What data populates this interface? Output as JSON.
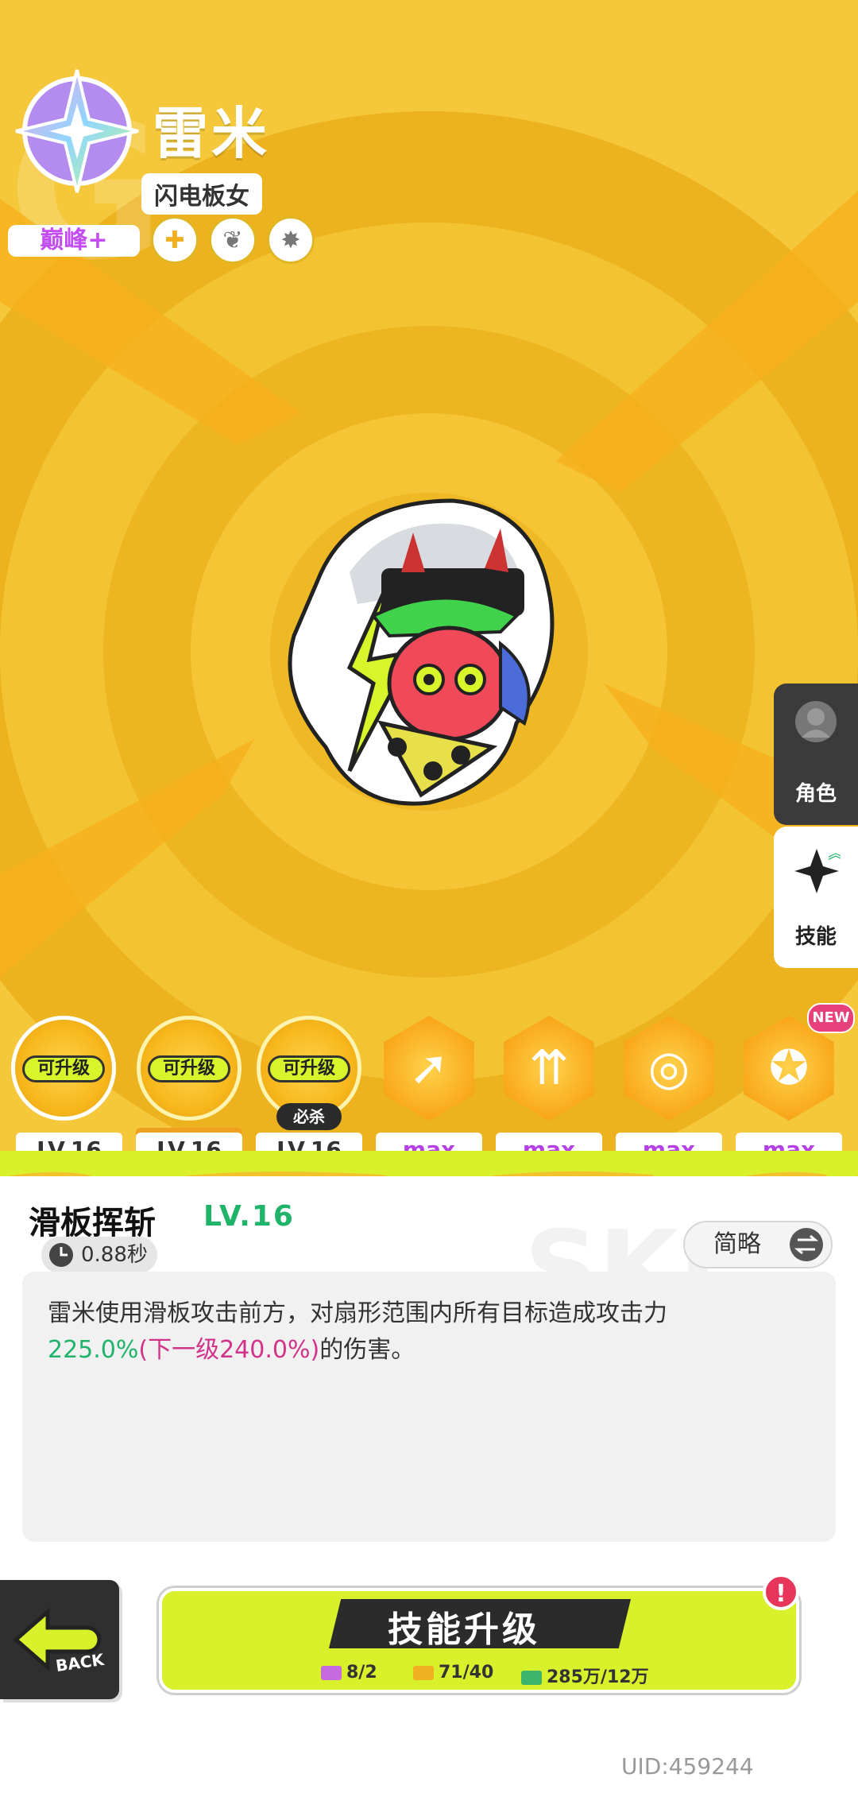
{
  "character": {
    "name": "雷米",
    "subtitle": "闪电板女",
    "rank": "巅峰+"
  },
  "side_tabs": [
    {
      "label": "角色",
      "icon": "person-icon"
    },
    {
      "label": "技能",
      "icon": "sparkle-icon"
    }
  ],
  "skills": [
    {
      "badge": "可升级",
      "level": "LV.16"
    },
    {
      "badge": "可升级",
      "level": "LV.16"
    },
    {
      "badge": "可升级",
      "level": "LV.16",
      "tag": "必杀"
    },
    {
      "level": "max"
    },
    {
      "level": "max"
    },
    {
      "level": "max"
    },
    {
      "level": "max",
      "new": "NEW"
    }
  ],
  "detail": {
    "title": "滑板挥斩",
    "level": "LV.16",
    "cooldown": "0.88秒",
    "toggle_label": "简略",
    "desc_line1": "雷米使用滑板攻击前方，对扇形范围内所有目标造成攻击力",
    "desc_value": "225.0%",
    "desc_next": "(下一级240.0%)",
    "desc_tail": "的伤害。"
  },
  "footer": {
    "back_label": "BACK",
    "upgrade_label": "技能升级",
    "costs": [
      "8/2",
      "71/40",
      "285万/12万"
    ],
    "alert": "!",
    "uid": "UID:459244"
  },
  "colors": {
    "accent_yellow": "#f2c22c",
    "lime": "#d9f12b",
    "level_green": "#1fb46a",
    "max_purple": "#b440e6",
    "next_magenta": "#d1338a"
  }
}
